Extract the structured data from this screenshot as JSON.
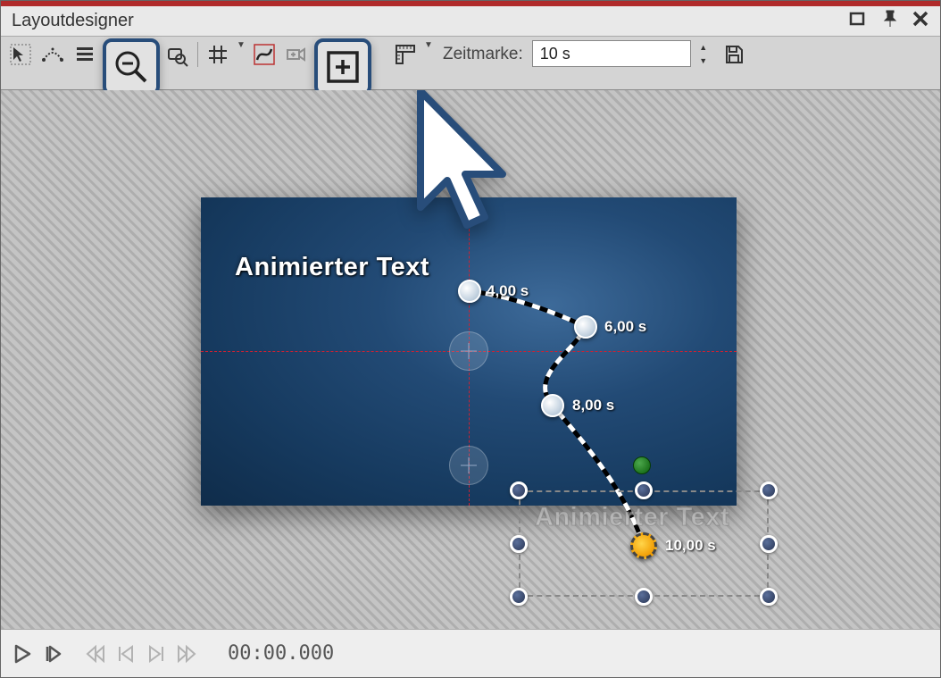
{
  "window": {
    "title": "Layoutdesigner"
  },
  "toolbar": {
    "time_label": "Zeitmarke:",
    "time_value": "10 s"
  },
  "canvas": {
    "main_text": "Animierter Text",
    "ghost_text": "Animierter Text",
    "keyframes": [
      {
        "t": "4,00 s"
      },
      {
        "t": "6,00 s"
      },
      {
        "t": "8,00 s"
      },
      {
        "t": "10,00 s"
      }
    ]
  },
  "playbar": {
    "timecode": "00:00.000"
  }
}
